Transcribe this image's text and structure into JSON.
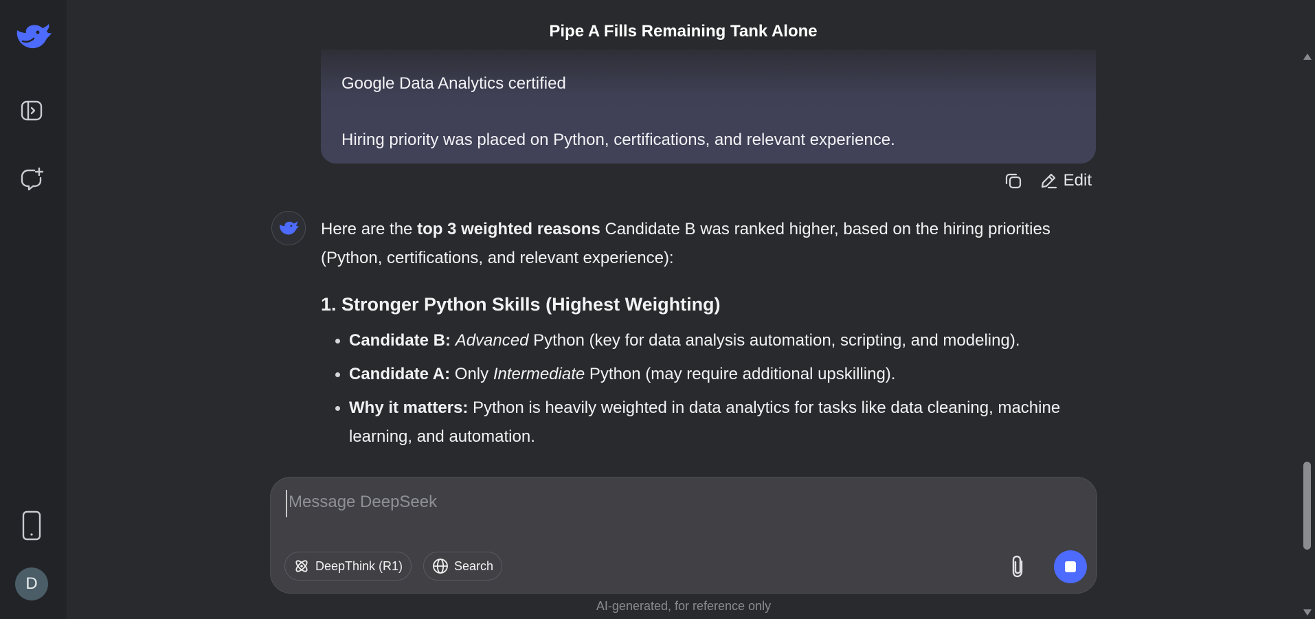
{
  "sidebar": {
    "logo_icon": "deepseek-whale-logo",
    "toggle_icon": "sidebar-toggle-icon",
    "new_chat_icon": "new-chat-icon",
    "phone_icon": "mobile-app-icon",
    "avatar_letter": "D",
    "accent": "#4d6bfe"
  },
  "header": {
    "title": "Pipe A Fills Remaining Tank Alone"
  },
  "user_message": {
    "line1": "Google Data Analytics certified",
    "line2": "Hiring priority was placed on Python, certifications, and relevant experience.",
    "edit_label": "Edit"
  },
  "assistant_message": {
    "intro_pre": "Here are the ",
    "intro_bold": "top 3 weighted reasons",
    "intro_post": " Candidate B was ranked higher, based on the hiring priorities (Python, certifications, and relevant experience):",
    "section1_title": "1. Stronger Python Skills (Highest Weighting)",
    "bullets": [
      {
        "label": "Candidate B:",
        "em": "Advanced",
        "rest": " Python (key for data analysis automation, scripting, and modeling)."
      },
      {
        "label": "Candidate A:",
        "pre": " Only ",
        "em": "Intermediate",
        "rest": " Python (may require additional upskilling)."
      },
      {
        "label": "Why it matters:",
        "rest": " Python is heavily weighted in data analytics for tasks like data cleaning, machine learning, and automation."
      }
    ]
  },
  "composer": {
    "placeholder": "Message DeepSeek",
    "deepthink_label": "DeepThink (R1)",
    "search_label": "Search"
  },
  "footer": {
    "note": "AI-generated, for reference only"
  }
}
